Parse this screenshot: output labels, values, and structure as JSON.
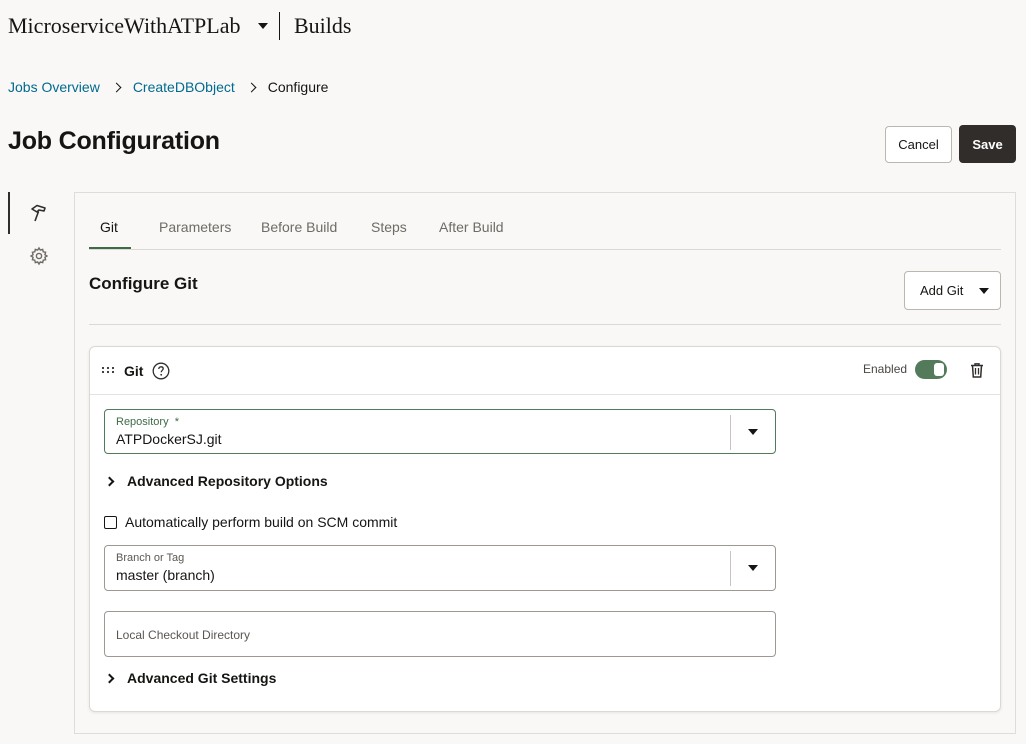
{
  "header": {
    "project": "MicroserviceWithATPLab",
    "section": "Builds"
  },
  "breadcrumb": {
    "items": [
      "Jobs Overview",
      "CreateDBObject"
    ],
    "current": "Configure"
  },
  "page": {
    "title": "Job Configuration",
    "cancel_label": "Cancel",
    "save_label": "Save"
  },
  "rail": {
    "icons": [
      "hammer-icon",
      "gear-icon"
    ]
  },
  "tabs": [
    "Git",
    "Parameters",
    "Before Build",
    "Steps",
    "After Build"
  ],
  "active_tab": "Git",
  "section": {
    "title": "Configure Git",
    "add_label": "Add Git"
  },
  "git_card": {
    "title": "Git",
    "enabled_label": "Enabled",
    "enabled": true,
    "repository": {
      "label": "Repository",
      "required_mark": "*",
      "value": "ATPDockerSJ.git"
    },
    "advanced_repo_label": "Advanced Repository Options",
    "auto_build": {
      "label": "Automatically perform build on SCM commit",
      "checked": false
    },
    "branch": {
      "label": "Branch or Tag",
      "value": "master (branch)"
    },
    "checkout_dir": {
      "placeholder": "Local Checkout Directory",
      "value": ""
    },
    "advanced_git_label": "Advanced Git Settings"
  },
  "colors": {
    "accent_green": "#537a5b",
    "link_blue": "#006b8f",
    "primary_button": "#312d2a",
    "background": "#f9f8f6"
  }
}
